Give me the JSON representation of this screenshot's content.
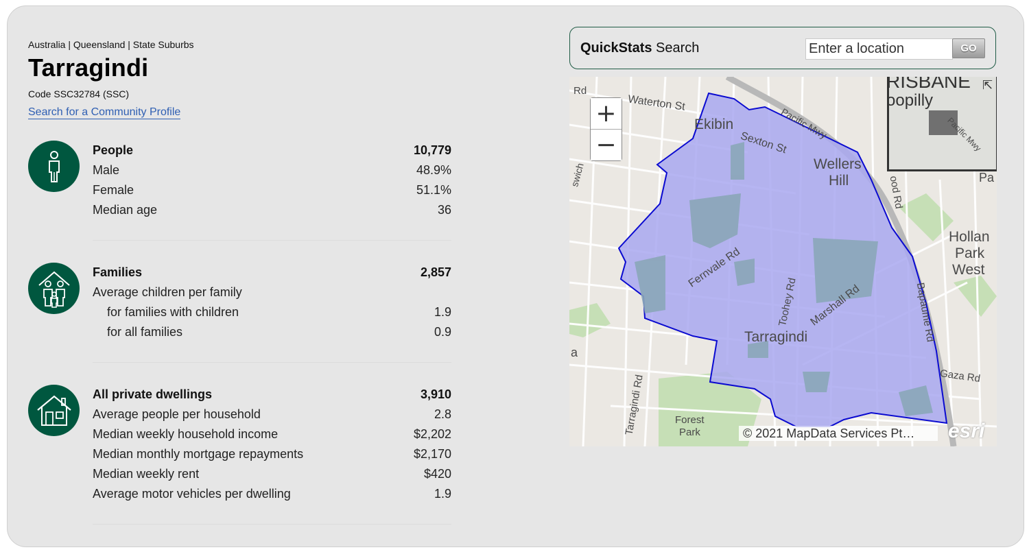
{
  "breadcrumb": "Australia | Queensland | State Suburbs",
  "title": "Tarragindi",
  "code": "Code SSC32784 (SSC)",
  "profile_link": "Search for a Community Profile",
  "sections": {
    "people": {
      "icon": "person-icon",
      "head": {
        "label": "People",
        "value": "10,779"
      },
      "rows": [
        {
          "label": "Male",
          "value": "48.9%"
        },
        {
          "label": "Female",
          "value": "51.1%"
        },
        {
          "label": "Median age",
          "value": "36"
        }
      ]
    },
    "families": {
      "icon": "family-icon",
      "head": {
        "label": "Families",
        "value": "2,857"
      },
      "rows": [
        {
          "label": "Average children per family",
          "value": ""
        },
        {
          "label": "for families with children",
          "value": "1.9"
        },
        {
          "label": "for all families",
          "value": "0.9"
        }
      ]
    },
    "dwellings": {
      "icon": "house-icon",
      "head": {
        "label": "All private dwellings",
        "value": "3,910"
      },
      "rows": [
        {
          "label": "Average people per household",
          "value": "2.8"
        },
        {
          "label": "Median weekly household income",
          "value": "$2,202"
        },
        {
          "label": "Median monthly mortgage repayments",
          "value": "$2,170"
        },
        {
          "label": "Median weekly rent",
          "value": "$420"
        },
        {
          "label": "Average motor vehicles per dwelling",
          "value": "1.9"
        }
      ]
    }
  },
  "quickstats": {
    "title_bold": "QuickStats",
    "title_rest": " Search",
    "placeholder": "Enter a location",
    "go_label": "GO"
  },
  "map": {
    "zoom_in": "+",
    "zoom_out": "−",
    "attribution": "© 2021 MapData Services Pt…",
    "logo": "esri",
    "labels": {
      "ekibin": "Ekibin",
      "wellers_hill": "Wellers",
      "wellers_hill2": "Hill",
      "tarragindi": "Tarragindi",
      "sexton": "Sexton St",
      "waterton": "Waterton St",
      "pacific": "Pacific Mwy",
      "fernvale": "Fernvale Rd",
      "toohey": "Toohey Rd",
      "marshall": "Marshall Rd",
      "bapaume": "Bapaume Rd",
      "gaza": "Gaza Rd",
      "tarragindi_rd": "Tarragindi Rd",
      "forest": "Forest",
      "park": "Park",
      "holland1": "Hollan",
      "holland2": "Park",
      "holland3": "West",
      "rd": "Rd",
      "a": "a",
      "wood_rd": "ood Rd",
      "swich": "swich",
      "pa": "Pa",
      "ov_oopilly": "oopilly",
      "ov_brisbane": "RISBANE",
      "ov_pacific": "Pacific Mwy"
    },
    "colors": {
      "suburb_fill": "#a9a8f0",
      "suburb_stroke": "#0a0ad0",
      "park": "#c6dfb6",
      "road": "#ffffff",
      "motorway": "#b8b8b8"
    }
  },
  "colors": {
    "accent": "#00573f",
    "link": "#2f5fb3",
    "card_bg": "#e6e6e6"
  }
}
